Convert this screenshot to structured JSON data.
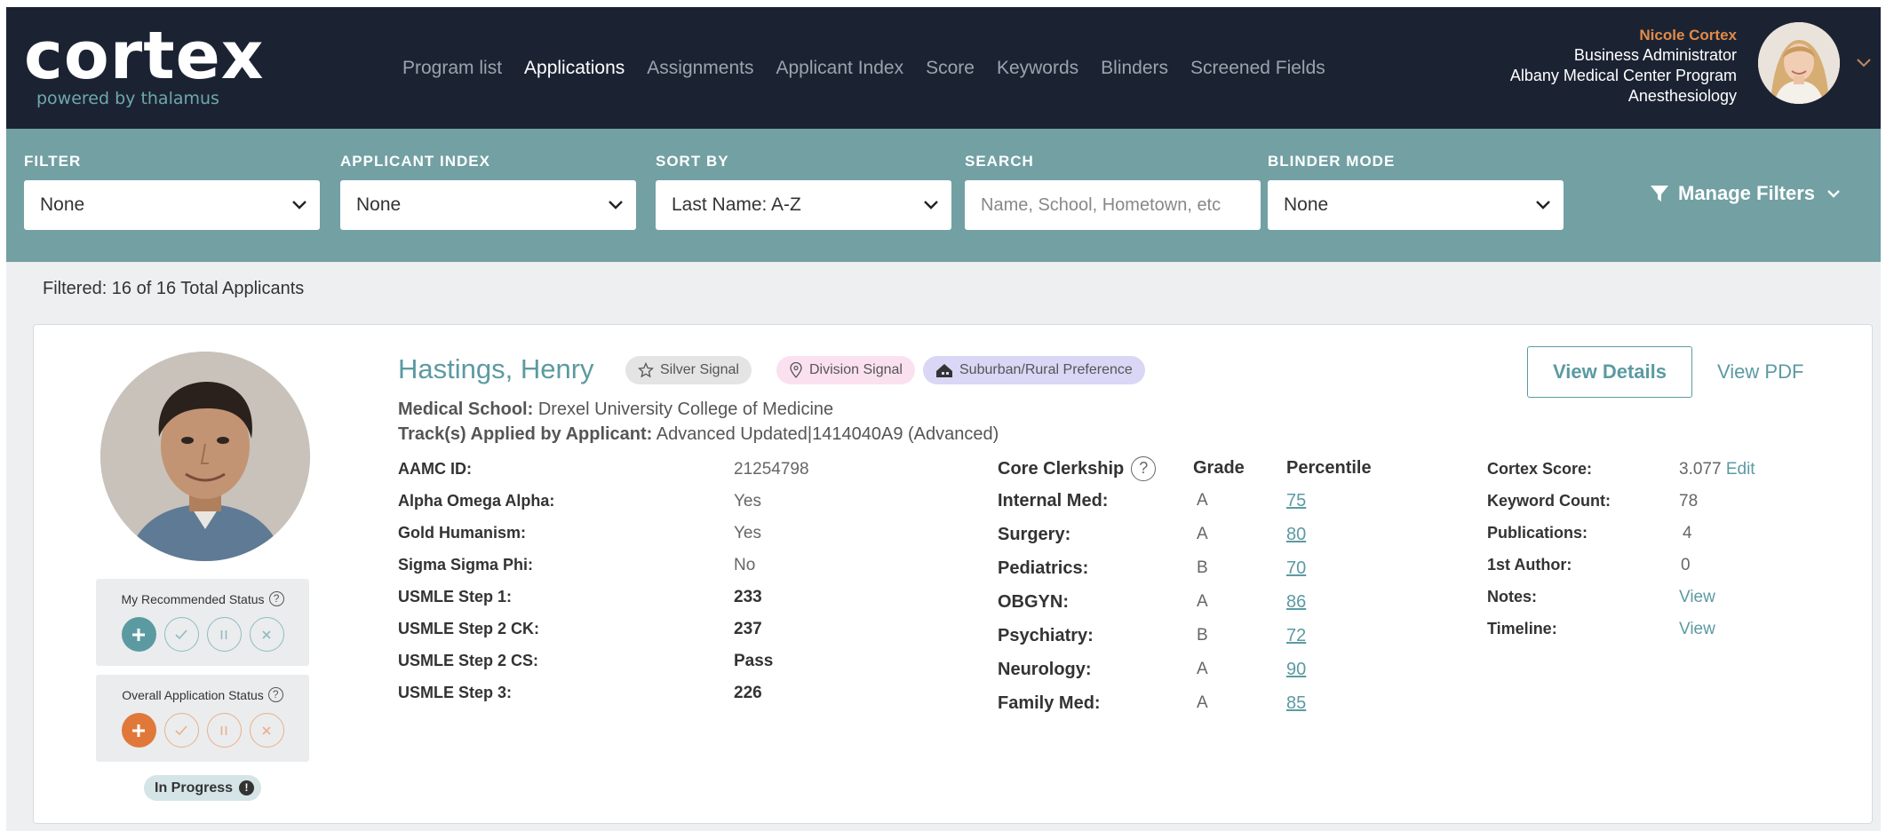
{
  "header": {
    "logo_word": "cortex",
    "logo_tagline": "powered by thalamus",
    "nav": [
      {
        "label": "Program list",
        "active": false
      },
      {
        "label": "Applications",
        "active": true
      },
      {
        "label": "Assignments",
        "active": false
      },
      {
        "label": "Applicant Index",
        "active": false
      },
      {
        "label": "Score",
        "active": false
      },
      {
        "label": "Keywords",
        "active": false
      },
      {
        "label": "Blinders",
        "active": false
      },
      {
        "label": "Screened Fields",
        "active": false
      }
    ],
    "user": {
      "name": "Nicole Cortex",
      "role": "Business Administrator",
      "program": "Albany Medical Center Program",
      "specialty": "Anesthesiology"
    }
  },
  "filters": {
    "filter": {
      "label": "FILTER",
      "value": "None"
    },
    "applicant_index": {
      "label": "APPLICANT INDEX",
      "value": "None"
    },
    "sort_by": {
      "label": "SORT BY",
      "value": "Last Name: A-Z"
    },
    "search": {
      "label": "SEARCH",
      "placeholder": "Name, School, Hometown, etc",
      "value": ""
    },
    "blinder_mode": {
      "label": "BLINDER MODE",
      "value": "None"
    },
    "manage_filters": "Manage Filters"
  },
  "results": {
    "filtered_text": "Filtered: 16 of 16 Total Applicants"
  },
  "applicant": {
    "name": "Hastings, Henry",
    "tags": [
      {
        "label": "Silver Signal",
        "icon": "star-icon",
        "color": "#e4e4e4"
      },
      {
        "label": "Division Signal",
        "icon": "location-pin-icon",
        "color": "#fbe1f0"
      },
      {
        "label": "Suburban/Rural Preference",
        "icon": "house-icon",
        "color": "#d9d6f6"
      }
    ],
    "medical_school_label": "Medical School:",
    "medical_school": "Drexel University College of Medicine",
    "tracks_label": "Track(s) Applied by Applicant:",
    "tracks": "Advanced Updated|1414040A9 (Advanced)",
    "details": [
      {
        "label": "AAMC ID:",
        "value": "21254798",
        "bold": false
      },
      {
        "label": "Alpha Omega Alpha:",
        "value": "Yes",
        "bold": false
      },
      {
        "label": "Gold Humanism:",
        "value": "Yes",
        "bold": false
      },
      {
        "label": "Sigma Sigma Phi:",
        "value": "No",
        "bold": false
      },
      {
        "label": "USMLE Step 1:",
        "value": "233",
        "bold": true
      },
      {
        "label": "USMLE Step 2 CK:",
        "value": "237",
        "bold": true
      },
      {
        "label": "USMLE Step 2 CS:",
        "value": "Pass",
        "bold": true
      },
      {
        "label": "USMLE Step 3:",
        "value": "226",
        "bold": true
      }
    ],
    "clerkship_header": {
      "core": "Core Clerkship",
      "grade": "Grade",
      "percentile": "Percentile"
    },
    "clerkships": [
      {
        "name": "Internal Med:",
        "grade": "A",
        "percentile": "75"
      },
      {
        "name": "Surgery:",
        "grade": "A",
        "percentile": "80"
      },
      {
        "name": "Pediatrics:",
        "grade": "B",
        "percentile": "70"
      },
      {
        "name": "OBGYN:",
        "grade": "A",
        "percentile": "86"
      },
      {
        "name": "Psychiatry:",
        "grade": "B",
        "percentile": "72"
      },
      {
        "name": "Neurology:",
        "grade": "A",
        "percentile": "90"
      },
      {
        "name": "Family Med:",
        "grade": "A",
        "percentile": "85"
      }
    ],
    "scores": [
      {
        "label": "Cortex Score:",
        "value": "3.077"
      },
      {
        "label": "Keyword Count:",
        "value": "78"
      },
      {
        "label": "Publications:",
        "value": "4"
      },
      {
        "label": "1st Author:",
        "value": "0"
      },
      {
        "label": "Notes:",
        "value": "View"
      },
      {
        "label": "Timeline:",
        "value": "View"
      }
    ],
    "cortex_score_edit": "Edit",
    "view_details": "View Details",
    "view_pdf": "View PDF",
    "my_recommended_status": "My Recommended Status",
    "overall_application_status": "Overall Application Status",
    "progress_status": "In Progress",
    "colors": {
      "teal": "#5c9aa2",
      "orange": "#e0783a",
      "navy": "#1b2333"
    }
  }
}
